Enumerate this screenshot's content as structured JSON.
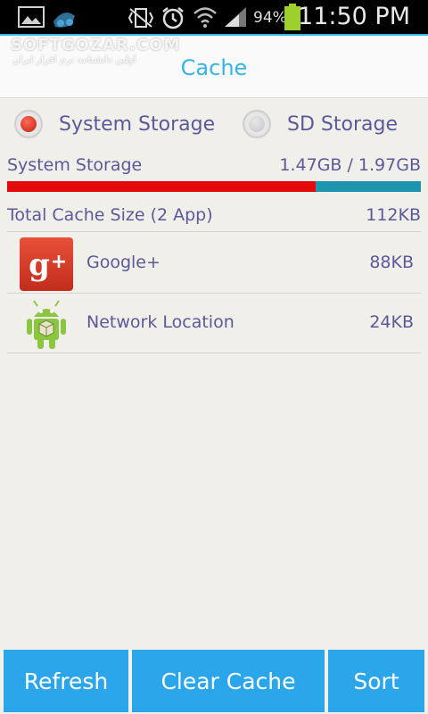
{
  "status_bar": {
    "battery_percent": "94%",
    "time": "11:50 PM",
    "icons": [
      "gallery-icon",
      "app-notification-icon",
      "vibrate-icon",
      "alarm-icon",
      "wifi-icon",
      "signal-icon",
      "battery-icon"
    ]
  },
  "watermark": {
    "brand": "SOFTGOZAR.COM",
    "tagline": "اولین دانشنامه نرم افزار ایران"
  },
  "header": {
    "title": "Cache"
  },
  "storage_selector": {
    "options": [
      {
        "label": "System Storage",
        "selected": true
      },
      {
        "label": "SD Storage",
        "selected": false
      }
    ]
  },
  "storage": {
    "label": "System Storage",
    "usage_text": "1.47GB / 1.97GB",
    "used_fraction": 0.746,
    "used_color": "#e20a0a",
    "free_color": "#1e95ae"
  },
  "summary": {
    "label": "Total Cache Size (2 App)",
    "size": "112KB"
  },
  "apps": [
    {
      "name": "Google+",
      "size": "88KB",
      "icon": "google-plus-icon"
    },
    {
      "name": "Network Location",
      "size": "24KB",
      "icon": "android-icon"
    }
  ],
  "actions": {
    "refresh": "Refresh",
    "clear_cache": "Clear Cache",
    "sort": "Sort"
  },
  "colors": {
    "accent": "#33b5e5",
    "button": "#2ba6ea",
    "text": "#5a5a9a"
  }
}
